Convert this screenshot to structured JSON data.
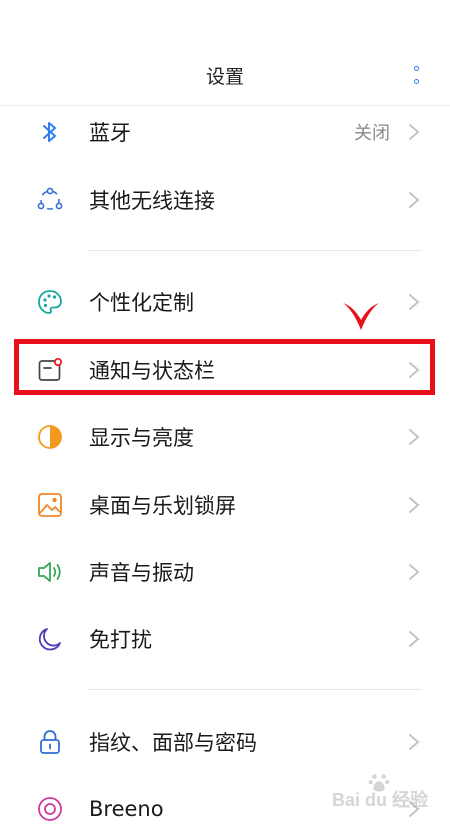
{
  "header": {
    "title": "设置"
  },
  "colors": {
    "accent": "#2f7ff0",
    "highlight": "#e8101a",
    "text": "#1a1a1a",
    "secondary_text": "#8a8a8a",
    "chevron": "#c4c4c4"
  },
  "settings": {
    "bluetooth": {
      "label": "蓝牙",
      "value": "关闭",
      "icon": "bluetooth-icon"
    },
    "wireless": {
      "label": "其他无线连接",
      "icon": "wireless-connection-icon"
    },
    "personalize": {
      "label": "个性化定制",
      "icon": "palette-icon"
    },
    "notification": {
      "label": "通知与状态栏",
      "icon": "notification-icon"
    },
    "display": {
      "label": "显示与亮度",
      "icon": "brightness-icon"
    },
    "desktop": {
      "label": "桌面与乐划锁屏",
      "icon": "wallpaper-icon"
    },
    "sound": {
      "label": "声音与振动",
      "icon": "speaker-icon"
    },
    "dnd": {
      "label": "免打扰",
      "icon": "moon-icon"
    },
    "security": {
      "label": "指纹、面部与密码",
      "icon": "lock-icon"
    },
    "breeno": {
      "label": "Breeno",
      "icon": "breeno-icon"
    }
  },
  "watermark": {
    "text": "Bai du 经验"
  }
}
